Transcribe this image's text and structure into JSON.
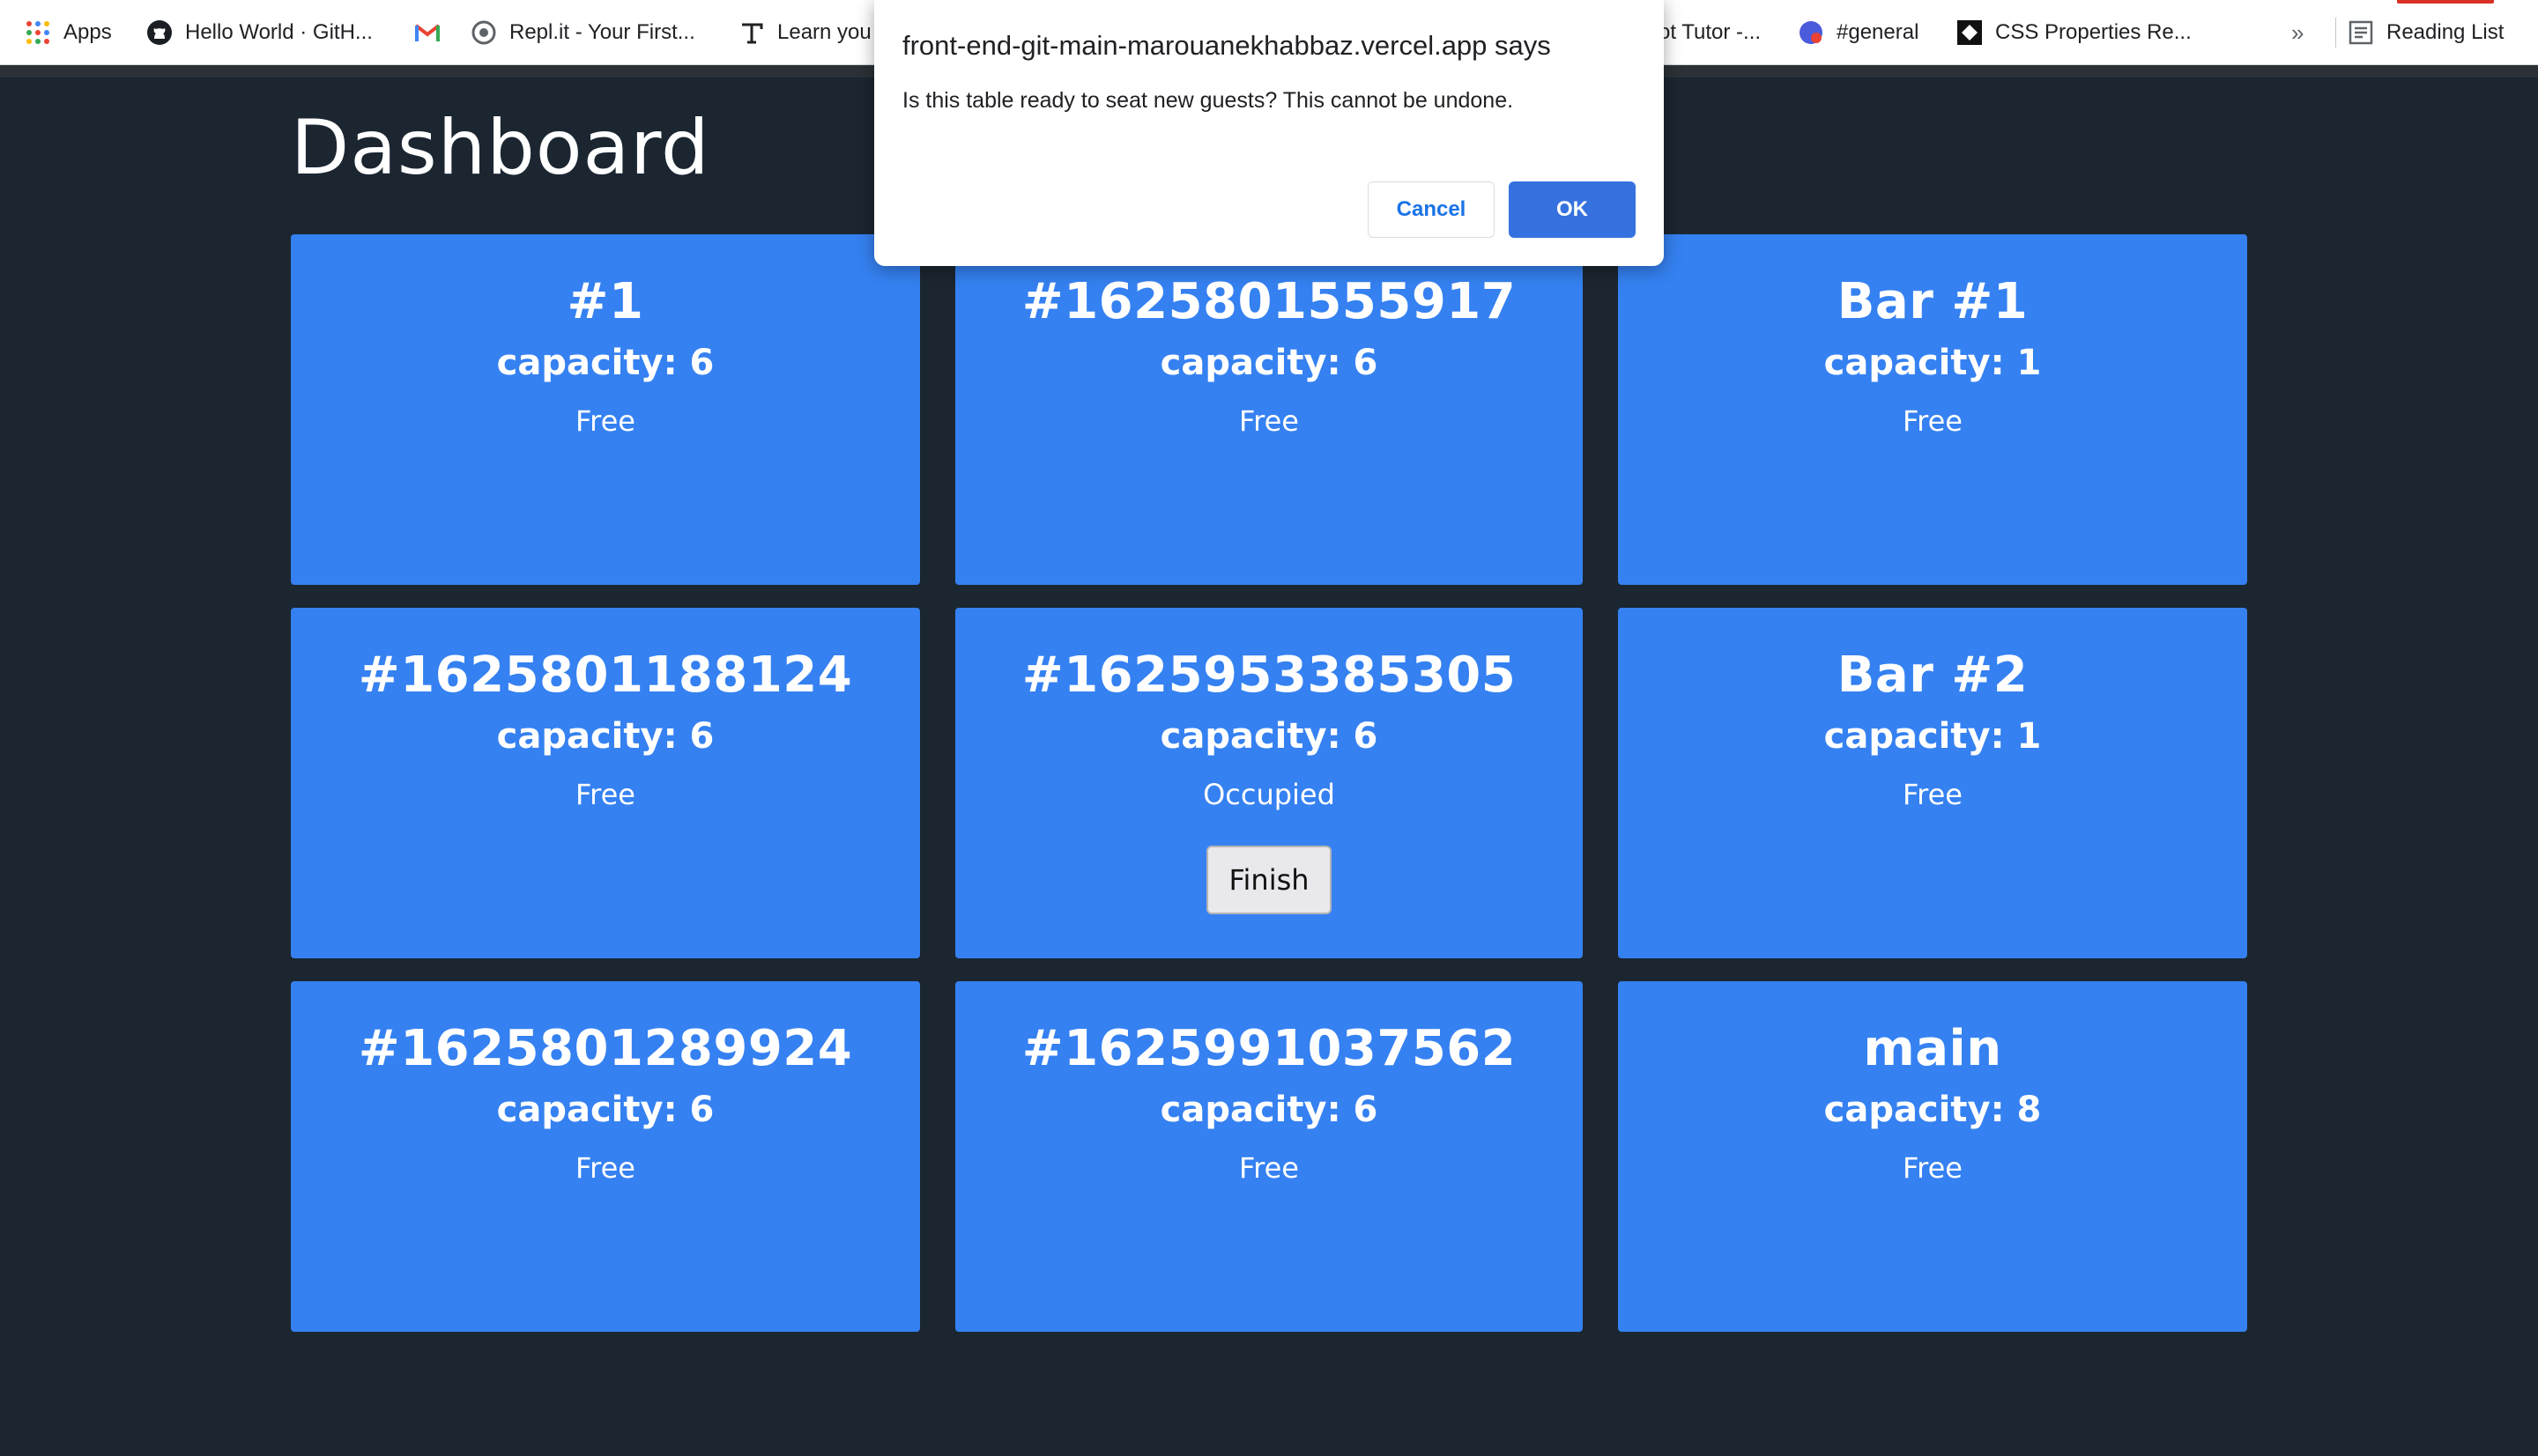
{
  "bookmarks": [
    {
      "label": "Apps",
      "icon": "apps-grid-icon"
    },
    {
      "label": "Hello World · GitH...",
      "icon": "github-icon"
    },
    {
      "label": "",
      "icon": "gmail-icon"
    },
    {
      "label": "Repl.it - Your First...",
      "icon": "replit-icon"
    },
    {
      "label": "Learn you",
      "icon": "typography-icon"
    },
    {
      "label": "ot Tutor -...",
      "icon": ""
    },
    {
      "label": "#general",
      "icon": "slack-like-icon"
    },
    {
      "label": "CSS Properties Re...",
      "icon": "codepen-icon"
    }
  ],
  "bookmarks_more": "»",
  "reading_list": {
    "label": "Reading List",
    "icon": "reading-list-icon"
  },
  "page": {
    "title": "Dashboard"
  },
  "tables": [
    {
      "name": "#1",
      "capacity": "capacity: 6",
      "status": "Free"
    },
    {
      "name": "#1625801555917",
      "capacity": "capacity: 6",
      "status": "Free"
    },
    {
      "name": "Bar #1",
      "capacity": "capacity: 1",
      "status": "Free"
    },
    {
      "name": "#1625801188124",
      "capacity": "capacity: 6",
      "status": "Free"
    },
    {
      "name": "#1625953385305",
      "capacity": "capacity: 6",
      "status": "Occupied",
      "action_label": "Finish"
    },
    {
      "name": "Bar #2",
      "capacity": "capacity: 1",
      "status": "Free"
    },
    {
      "name": "#1625801289924",
      "capacity": "capacity: 6",
      "status": "Free"
    },
    {
      "name": "#1625991037562",
      "capacity": "capacity: 6",
      "status": "Free"
    },
    {
      "name": "main",
      "capacity": "capacity: 8",
      "status": "Free"
    }
  ],
  "dialog": {
    "title": "front-end-git-main-marouanekhabbaz.vercel.app says",
    "message": "Is this table ready to seat new guests? This cannot be undone.",
    "cancel_label": "Cancel",
    "ok_label": "OK"
  },
  "colors": {
    "page_background": "#1b2631",
    "card_background": "#3581f1",
    "dialog_ok": "#3572df",
    "dialog_cancel_text": "#1a73e8"
  }
}
